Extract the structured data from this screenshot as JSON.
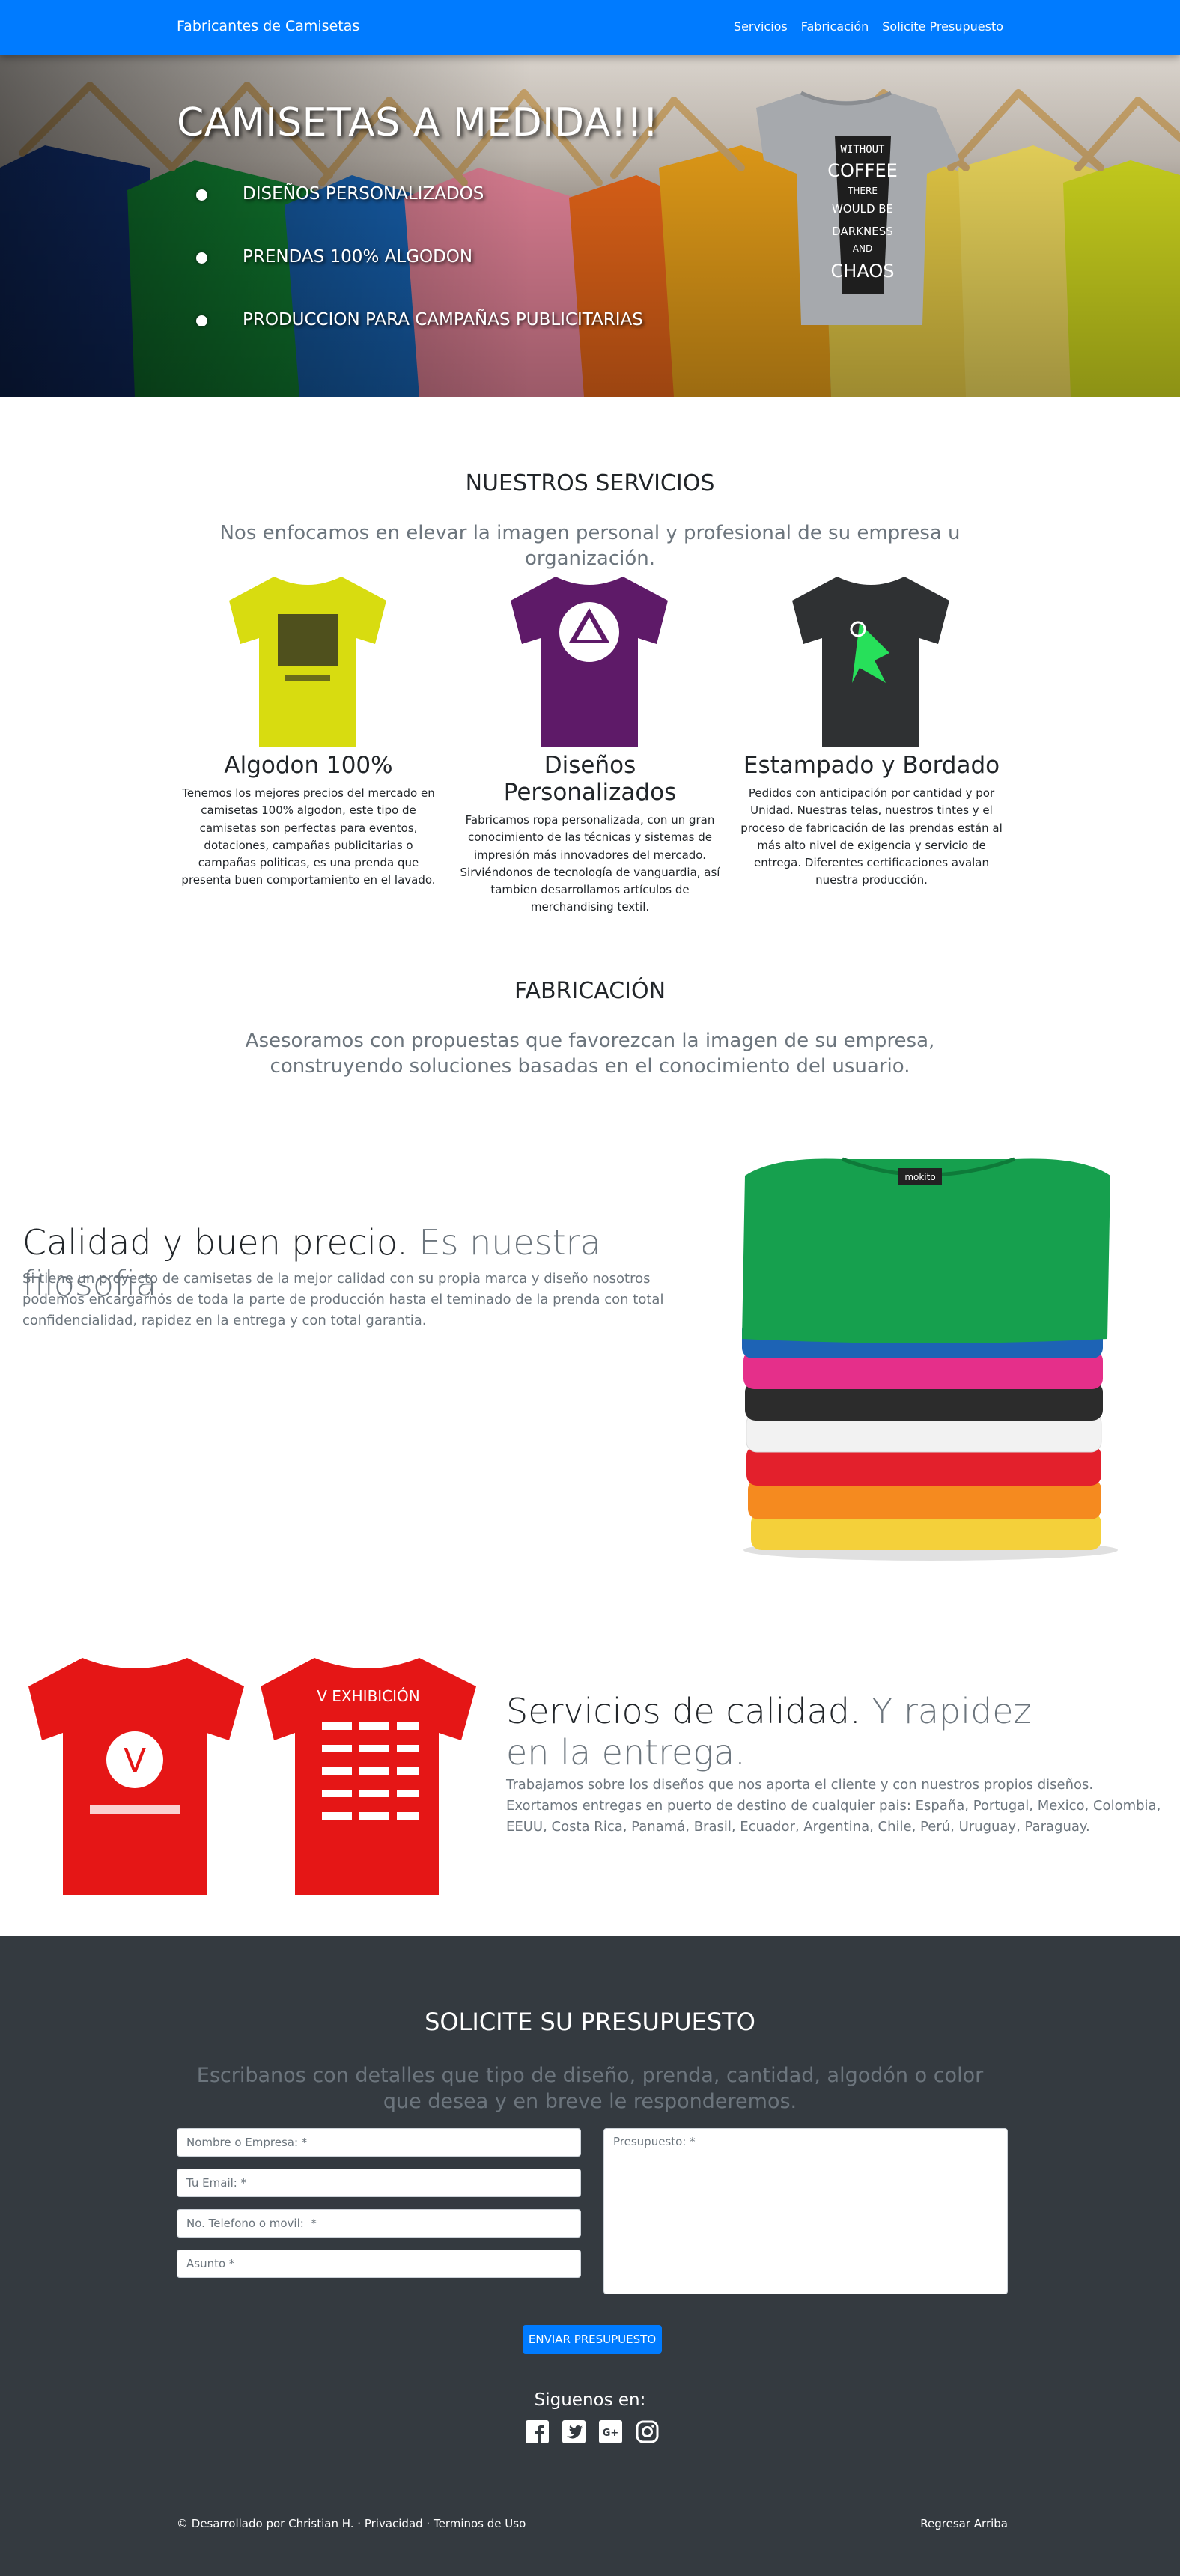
{
  "navbar": {
    "brand": "Fabricantes de Camisetas",
    "links": [
      "Servicios",
      "Fabricación",
      "Solicite Presupuesto"
    ]
  },
  "hero": {
    "title": "CAMISETAS A MEDIDA!!!",
    "bullets": [
      "DISEÑOS PERSONALIZADOS",
      "PRENDAS 100% ALGODON",
      "PRODUCCION PARA CAMPAÑAS PUBLICITARIAS"
    ],
    "shirt_print": [
      "WITHOUT",
      "COFFEE",
      "THERE",
      "WOULD BE",
      "DARKNESS",
      "AND",
      "CHAOS"
    ]
  },
  "services": {
    "title": "NUESTROS SERVICIOS",
    "lead": "Nos enfocamos en elevar la imagen personal y profesional de su empresa u organización.",
    "items": [
      {
        "title": "Algodon 100%",
        "text": "Tenemos los mejores precios del mercado en camisetas 100% algodon, este tipo de camisetas son perfectas para eventos, dotaciones, campañas publicitarias o campañas politicas, es una prenda que presenta buen comportamiento en el lavado.",
        "color": "#d8dc10"
      },
      {
        "title": "Diseños Personalizados",
        "text": "Fabricamos ropa personalizada, con un gran conocimiento de las técnicas y sistemas de impresión más innovadores del mercado. Sirviéndonos de tecnología de vanguardia, así tambien desarrollamos artículos de merchandising textil.",
        "color": "#5e1a68"
      },
      {
        "title": "Estampado y Bordado",
        "text": "Pedidos con anticipación por cantidad y por Unidad. Nuestras telas, nuestros tintes y el proceso de fabricación de las prendas están al más alto nivel de exigencia y servicio de entrega. Diferentes certificaciones avalan nuestra producción.",
        "color": "#2f3133"
      }
    ]
  },
  "fabrication": {
    "title": "FABRICACIÓN",
    "lead": "Asesoramos con propuestas que favorezcan la imagen de su empresa, construyendo soluciones basadas en el conocimiento del usuario."
  },
  "showcase1": {
    "heading": "Calidad y buen precio.",
    "heading_muted": "Es nuestra filosofia.",
    "text": "Si tiene un proyecto de camisetas de la mejor calidad con su propia marca y diseño nosotros podemos encargarnos de toda la parte de producción hasta el teminado de la prenda con total confidencialidad, rapidez en la entrega y con total garantia.",
    "stack_label": "mokito",
    "stack_colors": [
      "#f4d03a",
      "#f58a1f",
      "#e3202c",
      "#f2f2f2",
      "#2c2c2c",
      "#e52f8a",
      "#1d63b5",
      "#16a04e"
    ]
  },
  "showcase2": {
    "heading": "Servicios de calidad.",
    "heading_muted": "Y rapidez en la entrega.",
    "text": "Trabajamos sobre los diseños que nos aporta el cliente y con nuestros propios diseños. Exortamos entregas en puerto de destino de cualquier pais: España, Portugal, Mexico, Colombia, EEUU, Costa Rica, Panamá, Brasil, Ecuador, Argentina, Chile, Perú, Uruguay, Paraguay.",
    "shirt_text": "V EXHIBICIÓN"
  },
  "contact": {
    "title": "SOLICITE SU PRESUPUESTO",
    "lead": "Escribanos con detalles que tipo de diseño, prenda, cantidad, algodón o color que desea y en breve le responderemos.",
    "placeholders": {
      "name": "Nombre o Empresa: *",
      "email": "Tu Email: *",
      "phone": "No. Telefono o movil:  *",
      "subject": "Asunto *",
      "budget": "Presupuesto: *"
    },
    "button": "ENVIAR PRESUPUESTO",
    "follow": "Siguenos en:",
    "social_icons": [
      "facebook-icon",
      "twitter-icon",
      "google-plus-icon",
      "instagram-icon"
    ]
  },
  "footer": {
    "left": "© Desarrollado por Christian H. · Privacidad · Terminos de Uso",
    "right": "Regresar Arriba"
  }
}
